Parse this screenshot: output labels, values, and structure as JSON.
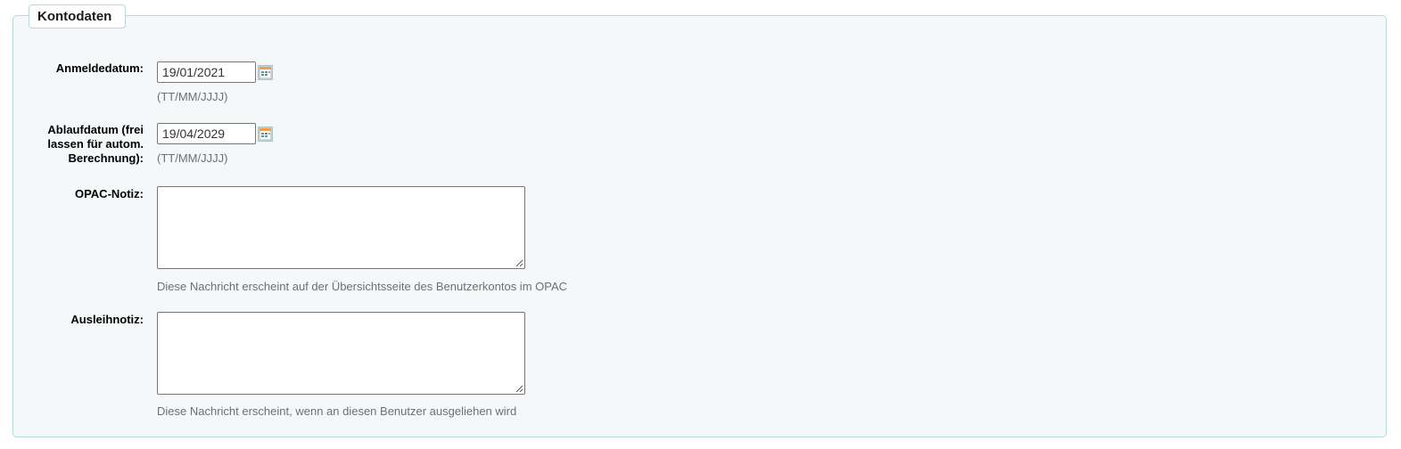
{
  "fieldset": {
    "legend": "Kontodaten"
  },
  "fields": {
    "registration_date": {
      "label": "Anmeldedatum:",
      "value": "19/01/2021",
      "hint": "(TT/MM/JJJJ)",
      "icon": "calendar-icon"
    },
    "expiry_date": {
      "label_line1": "Ablaufdatum (frei",
      "label_line2": "lassen für autom.",
      "label_line3": "Berechnung):",
      "value": "19/04/2029",
      "hint": "(TT/MM/JJJJ)",
      "icon": "calendar-icon"
    },
    "opac_note": {
      "label": "OPAC-Notiz:",
      "value": "",
      "hint": "Diese Nachricht erscheint auf der Übersichtsseite des Benutzerkontos im OPAC"
    },
    "circulation_note": {
      "label": "Ausleihnotiz:",
      "value": "",
      "hint": "Diese Nachricht erscheint, wenn an diesen Benutzer ausgeliehen wird"
    }
  },
  "colors": {
    "fieldset_bg": "#f4f8f9",
    "fieldset_border": "#b9d8d9",
    "hint_text": "#6f6f6f"
  }
}
